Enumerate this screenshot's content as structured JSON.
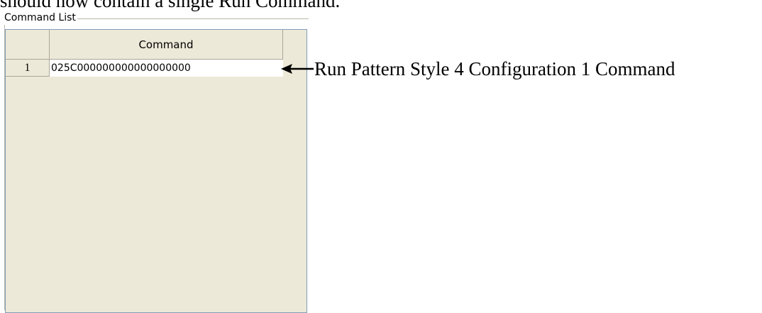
{
  "document": {
    "intro_text": "should now contain a single Run Command."
  },
  "command_list": {
    "caption": "Command List",
    "columns": [
      "Command"
    ],
    "rows": [
      {
        "number": "1",
        "command": "025C000000000000000000"
      }
    ]
  },
  "annotation": {
    "text": "Run Pattern Style 4 Configuration 1 Command",
    "arrow_icon": "left-arrow-icon"
  }
}
